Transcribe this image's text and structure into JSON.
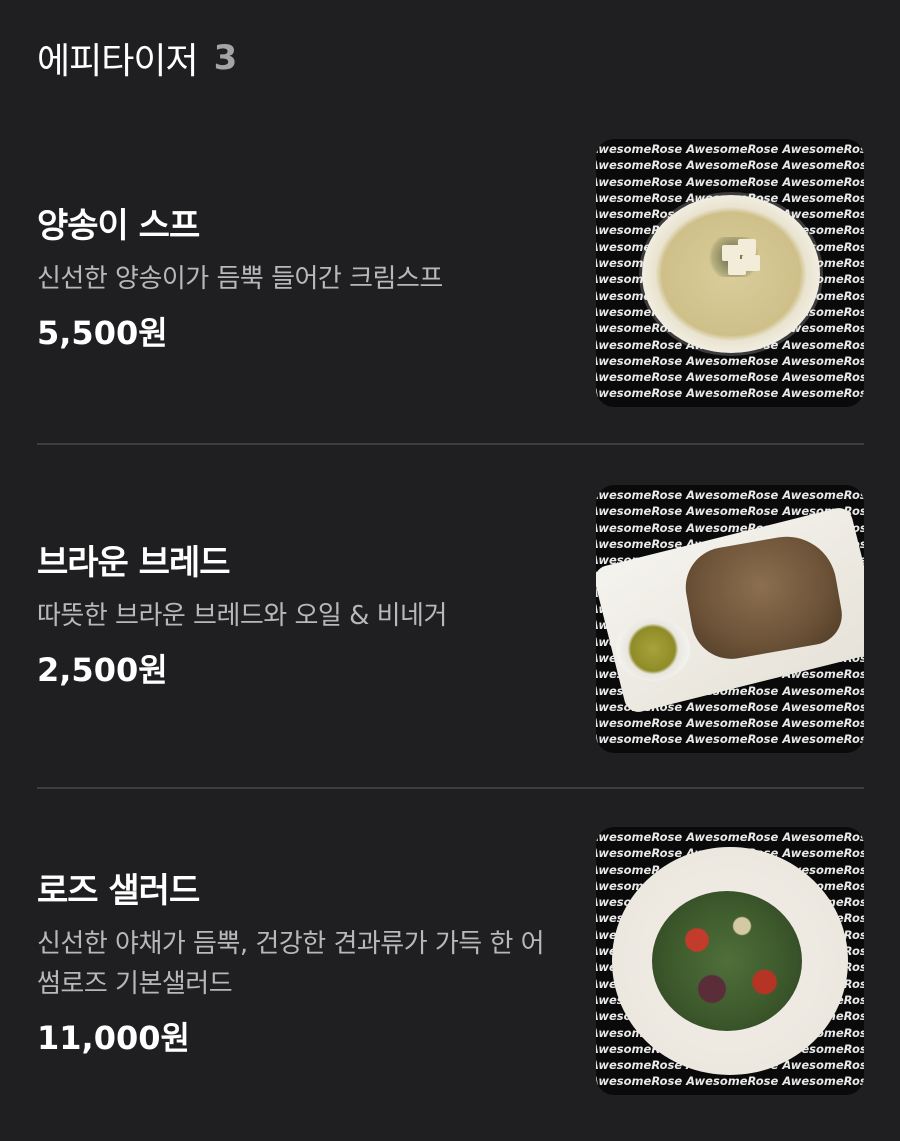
{
  "section": {
    "title": "에피타이저",
    "count": "3"
  },
  "watermark": "AwesomeRose AwesomeRose AwesomeRose",
  "items": [
    {
      "name": "양송이 스프",
      "description": "신선한 양송이가 듬뿍 들어간 크림스프",
      "price": "5,500원",
      "image_icon": "mushroom-soup-image"
    },
    {
      "name": "브라운 브레드",
      "description": "따뜻한 브라운 브레드와 오일 & 비네거",
      "price": "2,500원",
      "image_icon": "brown-bread-image"
    },
    {
      "name": "로즈 샐러드",
      "description": "신선한 야채가 듬뿍, 건강한 견과류가 가득 한 어썸로즈 기본샐러드",
      "price": "11,000원",
      "image_icon": "rose-salad-image"
    }
  ],
  "colors": {
    "background": "#1f1f21",
    "divider": "#3d3d40",
    "text_primary": "#ffffff",
    "text_secondary": "#b8b8ba",
    "count": "#a4a4a6"
  }
}
